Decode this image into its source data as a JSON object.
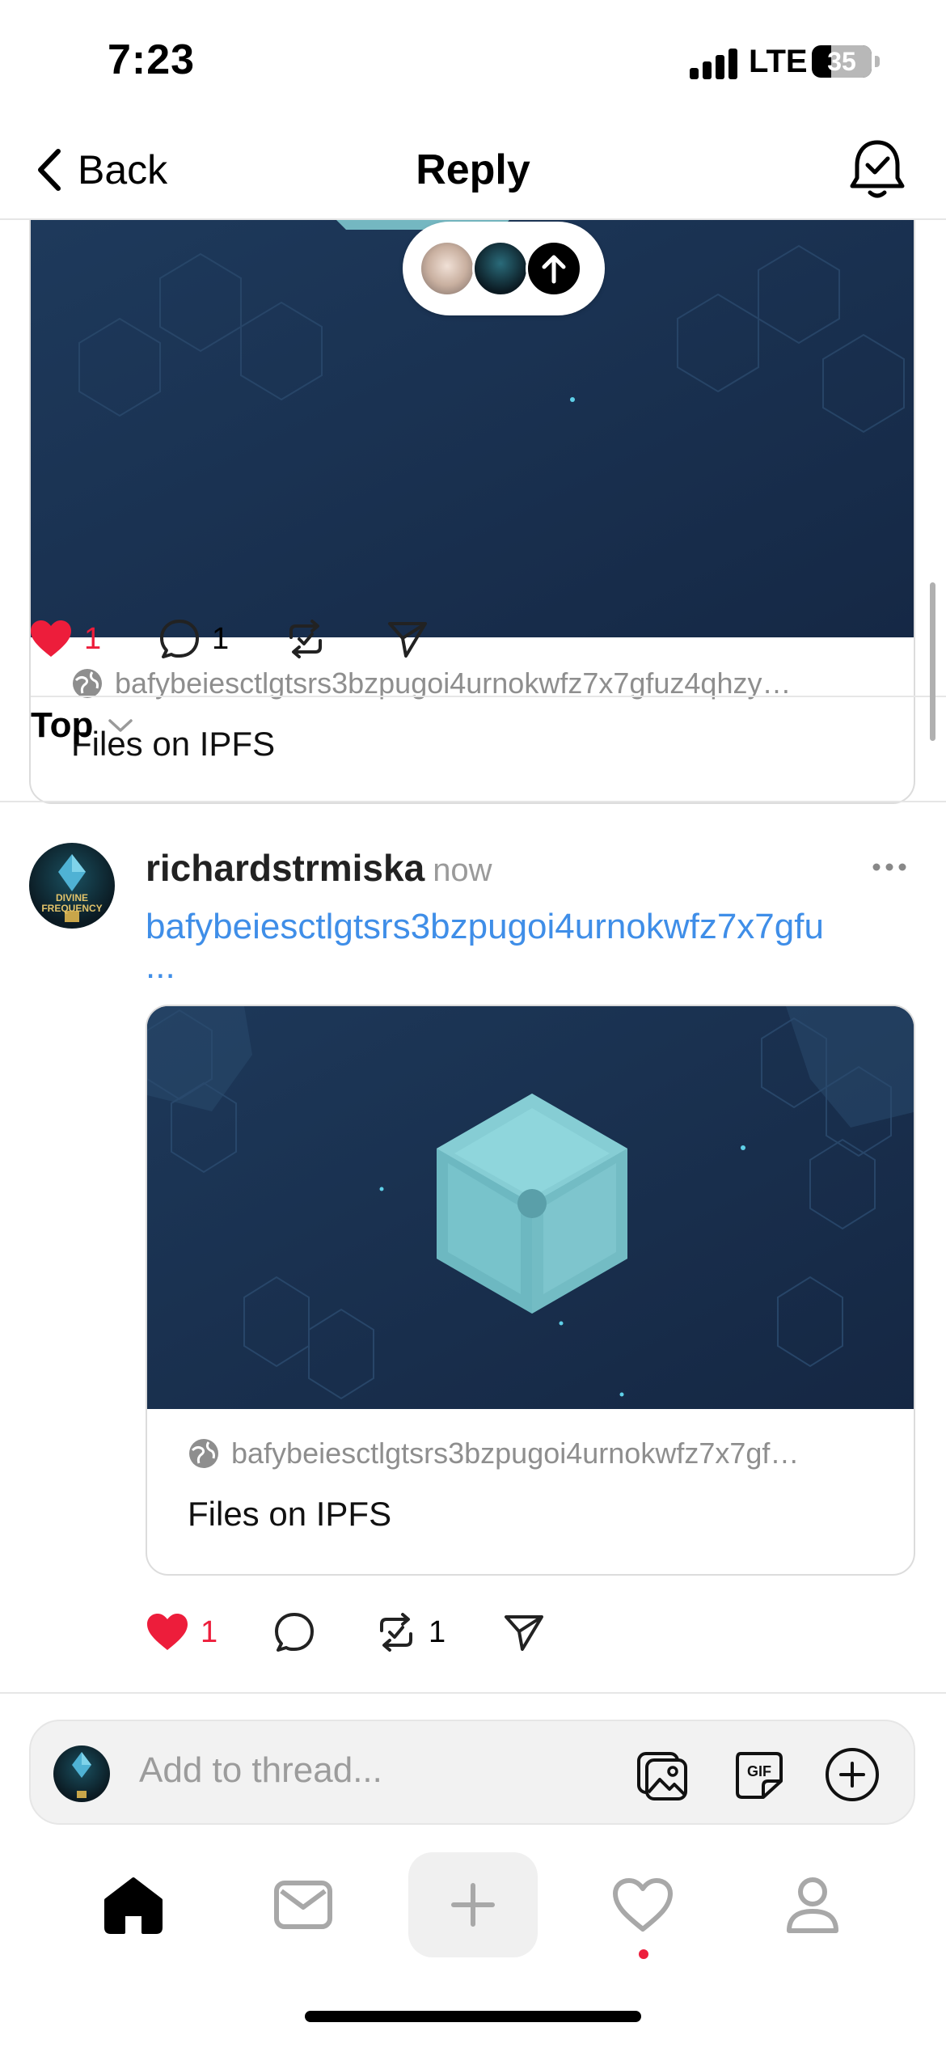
{
  "status_bar": {
    "time": "7:23",
    "network": "LTE",
    "battery": "35"
  },
  "header": {
    "back_label": "Back",
    "title": "Reply"
  },
  "quoted_post": {
    "link_domain": "bafybeiesctlgtsrs3bzpugoi4urnokwfz7x7gfuz4qhzy…",
    "link_title": "Files on IPFS",
    "likes": "1",
    "comments": "1"
  },
  "sort": {
    "label": "Top"
  },
  "reply": {
    "username": "richardstrmiska",
    "time": "now",
    "link_text": "bafybeiesctlgtsrs3bzpugoi4urnokwfz7x7gfu",
    "link_more": "...",
    "card_domain": "bafybeiesctlgtsrs3bzpugoi4urnokwfz7x7gf…",
    "card_title": "Files on IPFS",
    "likes": "1",
    "reposts": "1"
  },
  "composer": {
    "placeholder": "Add to thread..."
  },
  "avatar_text": {
    "line1": "DIVINE",
    "line2": "FREQUENCY"
  },
  "colors": {
    "like": "#ed1d3b",
    "link": "#3f8ee8",
    "card_bg": "#1b3150",
    "cube": "#7ec5cd"
  },
  "icons": {
    "back": "chevron-left-icon",
    "notifications": "bell-check-icon",
    "globe": "globe-icon",
    "like": "heart-filled-icon",
    "comment": "speech-bubble-icon",
    "repost": "repost-icon",
    "share": "paper-plane-icon",
    "sort": "chevron-down-icon",
    "more": "ellipsis-icon",
    "gallery": "image-gallery-icon",
    "gif": "gif-icon",
    "add": "plus-circle-icon",
    "home": "home-icon",
    "messages": "mail-icon",
    "create": "plus-icon",
    "activity": "heart-outline-icon",
    "profile": "person-icon"
  }
}
